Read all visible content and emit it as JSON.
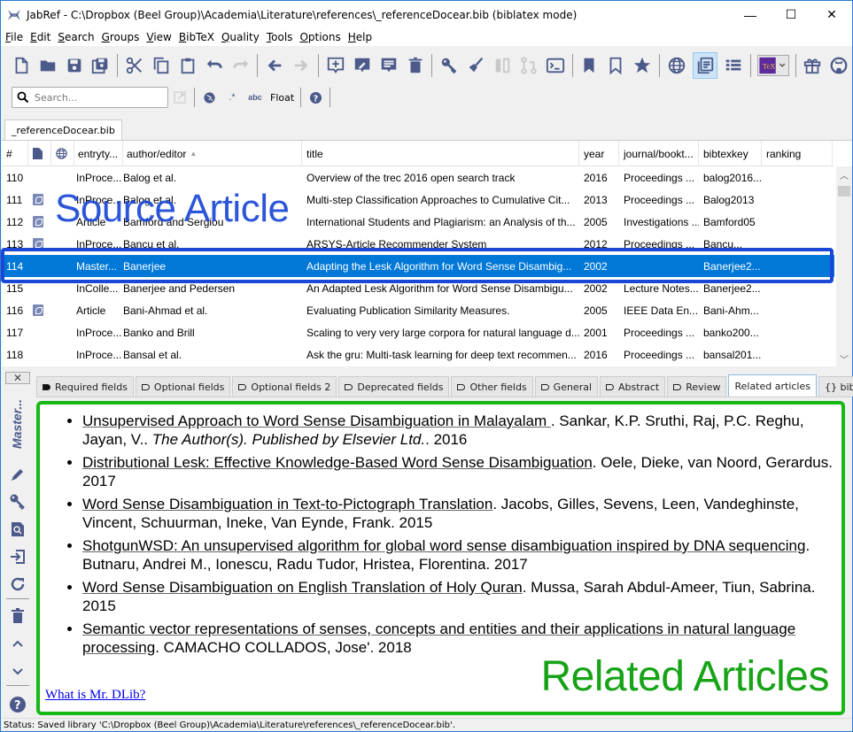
{
  "window": {
    "title": "JabRef - C:\\Dropbox (Beel Group)\\Academia\\Literature\\references\\_referenceDocear.bib (biblatex mode)",
    "controls": {
      "minimize": "—",
      "maximize": "☐",
      "close": "✕"
    }
  },
  "menu": [
    {
      "label": "File",
      "mnemonic": "F",
      "rest": "ile"
    },
    {
      "label": "Edit",
      "mnemonic": "E",
      "rest": "dit"
    },
    {
      "label": "Search",
      "mnemonic": "S",
      "rest": "earch"
    },
    {
      "label": "Groups",
      "mnemonic": "G",
      "rest": "roups"
    },
    {
      "label": "View",
      "mnemonic": "V",
      "rest": "iew"
    },
    {
      "label": "BibTeX",
      "mnemonic": "B",
      "rest": "ibTeX"
    },
    {
      "label": "Quality",
      "mnemonic": "Q",
      "rest": "uality"
    },
    {
      "label": "Tools",
      "mnemonic": "T",
      "rest": "ools"
    },
    {
      "label": "Options",
      "mnemonic": "O",
      "rest": "ptions"
    },
    {
      "label": "Help",
      "mnemonic": "H",
      "rest": "elp"
    }
  ],
  "toolbar": {
    "icons": [
      "new-library",
      "open-library",
      "save",
      "save-all",
      "cut",
      "copy",
      "paste",
      "undo",
      "redo",
      "back",
      "forward",
      "new-entry",
      "edit-entry",
      "edit-strings",
      "delete-entry",
      "search-key",
      "cleanup",
      "merge",
      "diff",
      "terminal",
      "mark-entry",
      "unmark-entry",
      "star",
      "web-search",
      "entry-editor",
      "table-view",
      "texstudio",
      "gift",
      "github"
    ],
    "accent_color": "#4b5a8a"
  },
  "search": {
    "placeholder": "Search...",
    "float_label": "Float",
    "regex_label": ".*",
    "case_label": "abc"
  },
  "library_tab": "_referenceDocear.bib",
  "table": {
    "columns": [
      "#",
      "",
      "",
      "entryty...",
      "author/editor",
      "title",
      "year",
      "journal/bookt...",
      "bibtexkey",
      "ranking"
    ],
    "sort_indicator": "▲",
    "rows": [
      {
        "num": "110",
        "pdf": false,
        "type": "InProce...",
        "author": "Balog et al.",
        "title": "Overview of the trec 2016 open search track",
        "year": "2016",
        "journal": "Proceedings ...",
        "key": "balog2016...",
        "ranking": ""
      },
      {
        "num": "111",
        "pdf": true,
        "type": "InProce...",
        "author": "Balog et al.",
        "title": "Multi-step Classification Approaches to Cumulative Cit...",
        "year": "2013",
        "journal": "Proceedings ...",
        "key": "Balog2013",
        "ranking": ""
      },
      {
        "num": "112",
        "pdf": true,
        "type": "Article",
        "author": "Bamford and Sergiou",
        "title": "International Students and Plagiarism: an Analysis of th...",
        "year": "2005",
        "journal": "Investigations ...",
        "key": "Bamford05",
        "ranking": ""
      },
      {
        "num": "113",
        "pdf": true,
        "type": "InProce...",
        "author": "Bancu et al.",
        "title": "ARSYS-Article Recommender System",
        "year": "2012",
        "journal": "Proceedings ...",
        "key": "Bancu...",
        "ranking": ""
      },
      {
        "num": "114",
        "pdf": false,
        "type": "Master...",
        "author": "Banerjee",
        "title": "Adapting the Lesk Algorithm for Word Sense Disambig...",
        "year": "2002",
        "journal": "",
        "key": "Banerjee2...",
        "ranking": "",
        "selected": true
      },
      {
        "num": "115",
        "pdf": false,
        "type": "InColle...",
        "author": "Banerjee and Pedersen",
        "title": "An Adapted Lesk Algorithm for Word Sense Disambigu...",
        "year": "2002",
        "journal": "Lecture Notes...",
        "key": "Banerjee2...",
        "ranking": ""
      },
      {
        "num": "116",
        "pdf": true,
        "type": "Article",
        "author": "Bani-Ahmad et al.",
        "title": "Evaluating Publication Similarity Measures.",
        "year": "2005",
        "journal": "IEEE Data En...",
        "key": "Bani-Ahm...",
        "ranking": ""
      },
      {
        "num": "117",
        "pdf": false,
        "type": "InProce...",
        "author": "Banko and Brill",
        "title": "Scaling to very very large corpora for natural language d...",
        "year": "2001",
        "journal": "Proceedings ...",
        "key": "banko200...",
        "ranking": ""
      },
      {
        "num": "118",
        "pdf": false,
        "type": "InProce...",
        "author": "Bansal et al.",
        "title": "Ask the gru: Multi-task learning for deep text recommen...",
        "year": "2016",
        "journal": "Proceedings ...",
        "key": "bansal201...",
        "ranking": ""
      }
    ]
  },
  "annotations": {
    "source_label": "Source Article",
    "source_color": "#1b47d6",
    "related_label": "Related Articles",
    "related_color": "#16b816"
  },
  "editor": {
    "side_title": "Master...",
    "close": "✕",
    "tabs": [
      {
        "label": "Required fields",
        "mark": "filled"
      },
      {
        "label": "Optional fields",
        "mark": "outline"
      },
      {
        "label": "Optional fields 2",
        "mark": "outline"
      },
      {
        "label": "Deprecated fields",
        "mark": "outline"
      },
      {
        "label": "Other fields",
        "mark": "outline"
      },
      {
        "label": "General",
        "mark": "outline"
      },
      {
        "label": "Abstract",
        "mark": "outline"
      },
      {
        "label": "Review",
        "mark": "outline"
      },
      {
        "label": "Related articles",
        "mark": "none",
        "active": true
      },
      {
        "label": "{} biblat",
        "mark": "none"
      }
    ],
    "side_icons": [
      "pencil",
      "key",
      "search-document",
      "import",
      "refresh",
      "delete",
      "chevron-up",
      "chevron-down",
      "help"
    ]
  },
  "related": {
    "items": [
      {
        "title": "Unsupervised Approach to Word Sense Disambiguation in Malayalam ",
        "authors": ". Sankar, K.P. Sruthi, Raj, P.C. Reghu, Jayan, V.. ",
        "venue": "The Author(s). Published by Elsevier Ltd.",
        "year": ". 2016"
      },
      {
        "title": "Distributional Lesk: Effective Knowledge-Based Word Sense Disambiguation",
        "authors": ". Oele, Dieke, van Noord, Gerardus",
        "venue": "",
        "year": ". 2017"
      },
      {
        "title": "Word Sense Disambiguation in Text-to-Pictograph Translation",
        "authors": ". Jacobs, Gilles, Sevens, Leen, Vandeghinste, Vincent, Schuurman, Ineke, Van Eynde, Frank",
        "venue": "",
        "year": ". 2015"
      },
      {
        "title": "ShotgunWSD: An unsupervised algorithm for global word sense disambiguation inspired by DNA sequencing",
        "authors": ". Butnaru, Andrei M., Ionescu, Radu Tudor, Hristea, Florentina",
        "venue": "",
        "year": ". 2017"
      },
      {
        "title": "Word Sense Disambiguation on English Translation of Holy Quran",
        "authors": ". Mussa, Sarah Abdul-Ameer, Tiun, Sabrina",
        "venue": "",
        "year": ". 2015"
      },
      {
        "title": "Semantic vector representations of senses, concepts and entities and their applications in natural language processing",
        "authors": ". CAMACHO COLLADOS, Jose'",
        "venue": "",
        "year": ". 2018"
      }
    ],
    "mrdlib_link": "What is Mr. DLib?"
  },
  "status": {
    "text": "Status: Saved library 'C:\\Dropbox (Beel Group)\\Academia\\Literature\\references\\_referenceDocear.bib'."
  }
}
